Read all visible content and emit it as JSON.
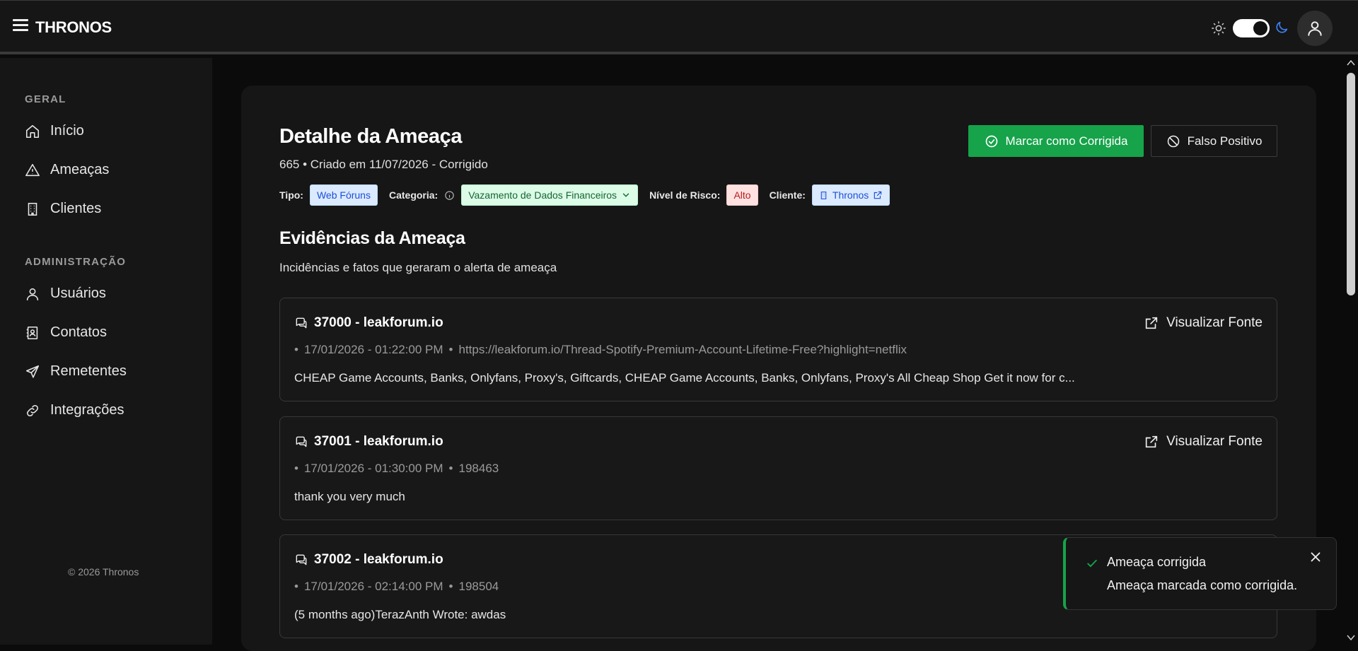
{
  "app": {
    "brand": "THRONOS"
  },
  "sidebar": {
    "sections": [
      {
        "label": "GERAL",
        "items": [
          {
            "label": "Início",
            "icon": "home-icon"
          },
          {
            "label": "Ameaças",
            "icon": "alert-triangle-icon"
          },
          {
            "label": "Clientes",
            "icon": "building-icon"
          }
        ]
      },
      {
        "label": "ADMINISTRAÇÃO",
        "items": [
          {
            "label": "Usuários",
            "icon": "user-icon"
          },
          {
            "label": "Contatos",
            "icon": "contact-book-icon"
          },
          {
            "label": "Remetentes",
            "icon": "send-icon"
          },
          {
            "label": "Integrações",
            "icon": "link-icon"
          }
        ]
      }
    ],
    "footer": "© 2026 Thronos"
  },
  "detail": {
    "title": "Detalhe da Ameaça",
    "subtitle": "665 • Criado em 11/07/2026 - Corrigido",
    "btn_fixed": "Marcar como Corrigida",
    "btn_false_positive": "Falso Positivo",
    "meta": {
      "tipo_label": "Tipo:",
      "tipo_value": "Web Fóruns",
      "categoria_label": "Categoria:",
      "categoria_value": "Vazamento de Dados Financeiros",
      "risco_label": "Nível de Risco:",
      "risco_value": "Alto",
      "cliente_label": "Cliente:",
      "cliente_value": "Thronos"
    }
  },
  "evidences": {
    "title": "Evidências da Ameaça",
    "subtitle": "Incidências e fatos que geraram o alerta de ameaça",
    "link_label": "Visualizar Fonte",
    "items": [
      {
        "title": "37000 - leakforum.io",
        "bullet": "•",
        "date": "17/01/2026 - 01:22:00 PM",
        "sep": "•",
        "ref": "https://leakforum.io/Thread-Spotify-Premium-Account-Lifetime-Free?highlight=netflix",
        "text": "CHEAP Game Accounts, Banks, Onlyfans, Proxy's, Giftcards, CHEAP Game Accounts, Banks, Onlyfans, Proxy's All Cheap Shop Get it now for c..."
      },
      {
        "title": "37001 - leakforum.io",
        "bullet": "•",
        "date": "17/01/2026 - 01:30:00 PM",
        "sep": "•",
        "ref": "198463",
        "text": "thank you very much"
      },
      {
        "title": "37002 - leakforum.io",
        "bullet": "•",
        "date": "17/01/2026 - 02:14:00 PM",
        "sep": "•",
        "ref": "198504",
        "text": "(5 months ago)TerazAnth Wrote: awdas"
      }
    ]
  },
  "toast": {
    "title": "Ameaça corrigida",
    "message": "Ameaça marcada como corrigida."
  },
  "colors": {
    "accent_green": "#16a34a",
    "link_blue": "#1d4ed8",
    "risk_red": "#b91c1c",
    "moon_blue": "#3b82f6"
  }
}
